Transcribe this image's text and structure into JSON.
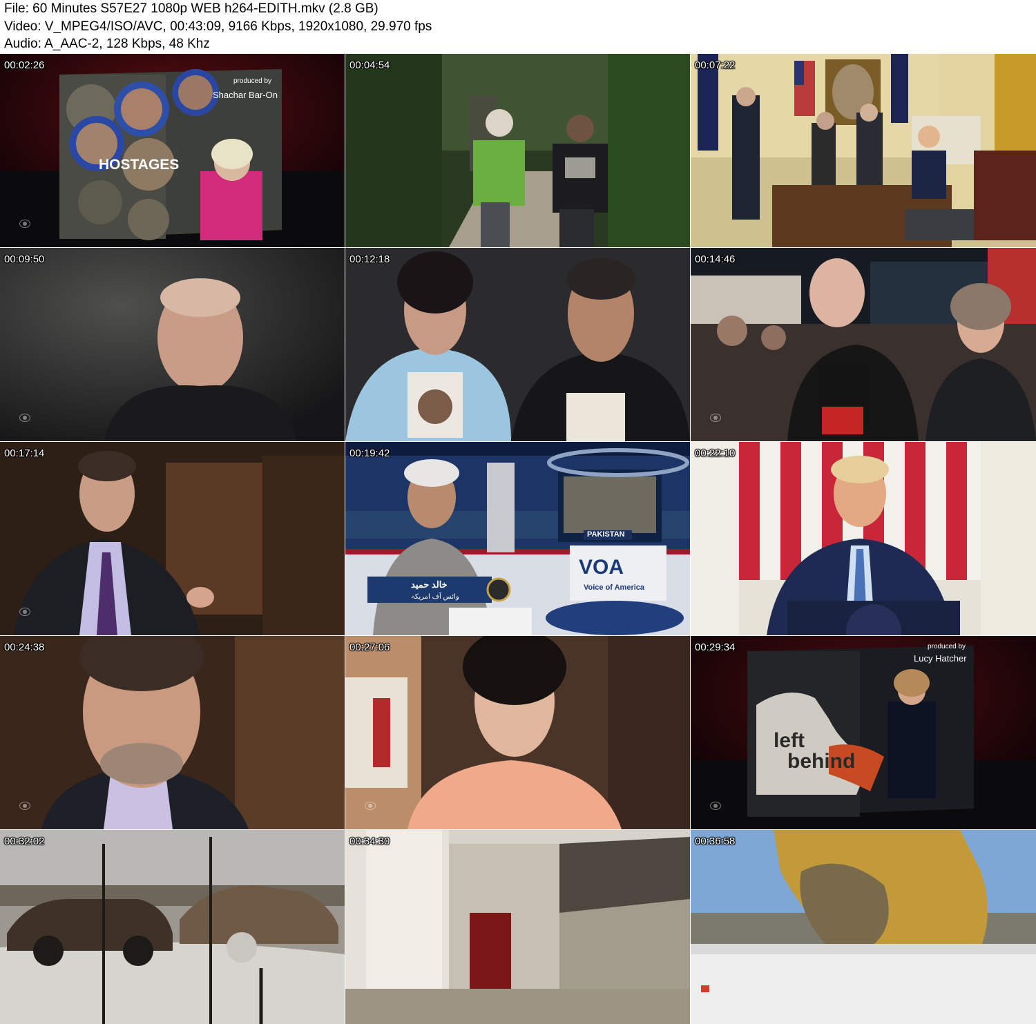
{
  "header": {
    "file_line": "File: 60 Minutes S57E27 1080p WEB h264-EDITH.mkv (2.8 GB)",
    "video_line": "Video: V_MPEG4/ISO/AVC, 00:43:09, 9166 Kbps, 1920x1080, 29.970 fps",
    "audio_line": "Audio: A_AAC-2, 128 Kbps, 48 Khz"
  },
  "thumbnails": [
    {
      "time": "00:02:26",
      "overlay": [
        "produced by",
        "Shachar Bar-On",
        "HOSTAGES"
      ]
    },
    {
      "time": "00:04:54"
    },
    {
      "time": "00:07:22"
    },
    {
      "time": "00:09:50"
    },
    {
      "time": "00:12:18"
    },
    {
      "time": "00:14:46"
    },
    {
      "time": "00:17:14"
    },
    {
      "time": "00:19:42",
      "overlay": [
        "PAKISTAN",
        "Voice of America",
        "خالد حمید",
        "وائس آف امریکہ"
      ]
    },
    {
      "time": "00:22:10"
    },
    {
      "time": "00:24:38"
    },
    {
      "time": "00:27:06"
    },
    {
      "time": "00:29:34",
      "overlay": [
        "produced by",
        "Lucy Hatcher",
        "left",
        "behind"
      ]
    },
    {
      "time": "00:32:02"
    },
    {
      "time": "00:34:30"
    },
    {
      "time": "00:36:58"
    }
  ]
}
